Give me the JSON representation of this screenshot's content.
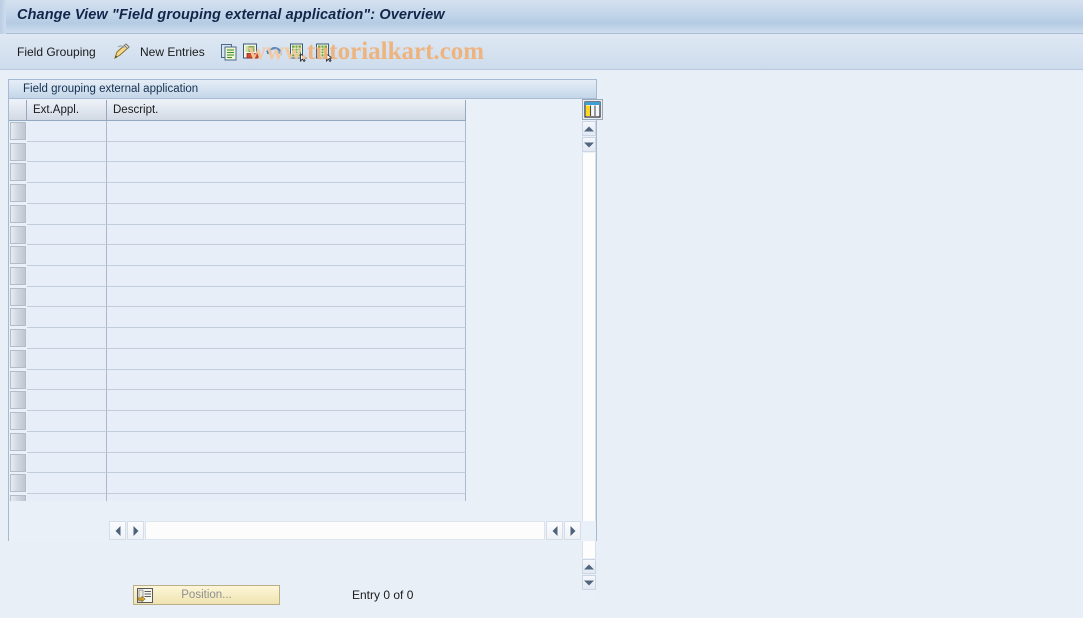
{
  "window": {
    "title": "Change View \"Field grouping external application\": Overview"
  },
  "toolbar": {
    "field_grouping_label": "Field Grouping",
    "new_entries_label": "New Entries",
    "icons": [
      {
        "name": "display-change-pencil-icon",
        "title": "Display/Change"
      },
      {
        "name": "copy-as-icon",
        "title": "Copy As..."
      },
      {
        "name": "delete-icon",
        "title": "Delete"
      },
      {
        "name": "undo-icon",
        "title": "Undo Change"
      },
      {
        "name": "select-all-icon",
        "title": "Select All"
      },
      {
        "name": "deselect-all-icon",
        "title": "Deselect All"
      }
    ]
  },
  "watermark": {
    "prefix": "www.",
    "text": "tutorialkart.com",
    "color": "#f0b27a"
  },
  "panel": {
    "caption": "Field grouping external application",
    "columns": [
      {
        "key": "corner",
        "label": ""
      },
      {
        "key": "ext_appl",
        "label": "Ext.Appl."
      },
      {
        "key": "descript",
        "label": "Descript."
      }
    ],
    "rows": [
      {
        "ext_appl": "",
        "descript": ""
      },
      {
        "ext_appl": "",
        "descript": ""
      },
      {
        "ext_appl": "",
        "descript": ""
      },
      {
        "ext_appl": "",
        "descript": ""
      },
      {
        "ext_appl": "",
        "descript": ""
      },
      {
        "ext_appl": "",
        "descript": ""
      },
      {
        "ext_appl": "",
        "descript": ""
      },
      {
        "ext_appl": "",
        "descript": ""
      },
      {
        "ext_appl": "",
        "descript": ""
      },
      {
        "ext_appl": "",
        "descript": ""
      },
      {
        "ext_appl": "",
        "descript": ""
      },
      {
        "ext_appl": "",
        "descript": ""
      },
      {
        "ext_appl": "",
        "descript": ""
      },
      {
        "ext_appl": "",
        "descript": ""
      },
      {
        "ext_appl": "",
        "descript": ""
      },
      {
        "ext_appl": "",
        "descript": ""
      },
      {
        "ext_appl": "",
        "descript": ""
      },
      {
        "ext_appl": "",
        "descript": ""
      },
      {
        "ext_appl": "",
        "descript": ""
      }
    ],
    "table_config_icon": "table-settings-icon"
  },
  "footer": {
    "position_button_label": "Position...",
    "entry_count": "Entry 0 of 0"
  },
  "colors": {
    "page_background": "#e9eff7",
    "title_text": "#12264a",
    "grid_cell": "#e8eef7",
    "accent_button": "#f6edc4"
  }
}
